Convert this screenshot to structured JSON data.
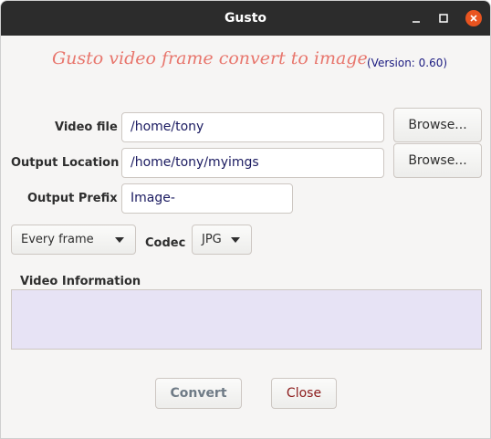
{
  "window": {
    "title": "Gusto",
    "controls": {
      "minimize_icon": "minimize-icon",
      "maximize_icon": "maximize-icon",
      "close_icon": "close-icon",
      "close_color": "#e95420"
    }
  },
  "header": {
    "app_title": "Gusto video frame convert to image",
    "version": "(Version: 0.60)"
  },
  "form": {
    "video_file": {
      "label": "Video file",
      "value": "/home/tony",
      "browse_label": "Browse..."
    },
    "output_location": {
      "label": "Output Location",
      "value": "/home/tony/myimgs",
      "browse_label": "Browse..."
    },
    "output_prefix": {
      "label": "Output Prefix",
      "value": "Image-"
    },
    "frame_mode": {
      "selected": "Every frame"
    },
    "codec": {
      "label": "Codec",
      "selected": "JPG"
    }
  },
  "video_information": {
    "label": "Video Information",
    "value": ""
  },
  "actions": {
    "convert_label": "Convert",
    "close_label": "Close"
  },
  "colors": {
    "heading": "#e8766d",
    "version": "#1a1a80",
    "info_background": "#e7e3f5",
    "close_button_text": "#8b1a1a",
    "convert_button_text": "#6f7b86"
  }
}
